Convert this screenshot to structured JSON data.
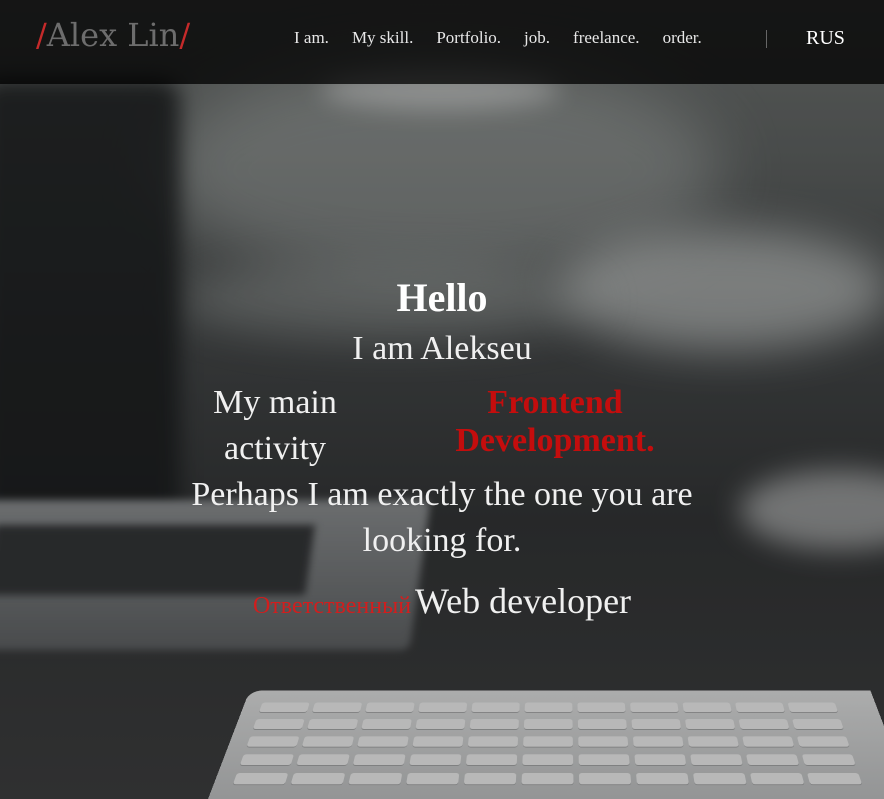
{
  "header": {
    "logo": {
      "slash_left": "/",
      "name": "Alex Lin",
      "slash_right": "/"
    },
    "nav": [
      {
        "label": "I am."
      },
      {
        "label": "My skill."
      },
      {
        "label": "Portfolio."
      },
      {
        "label": "job."
      },
      {
        "label": "freelance."
      },
      {
        "label": "order."
      }
    ],
    "language": "RUS"
  },
  "hero": {
    "greeting": "Hello",
    "intro": "I am Alekseu",
    "activity_label": "My main activity",
    "activity_value": "Frontend Development.",
    "pitch": "Perhaps I am exactly the one you are looking for.",
    "role_adjective": "Ответственный",
    "role": "Web developer"
  },
  "colors": {
    "accent": "#c40d0d",
    "header_bg": "#000000",
    "text": "#f0f0f0"
  }
}
